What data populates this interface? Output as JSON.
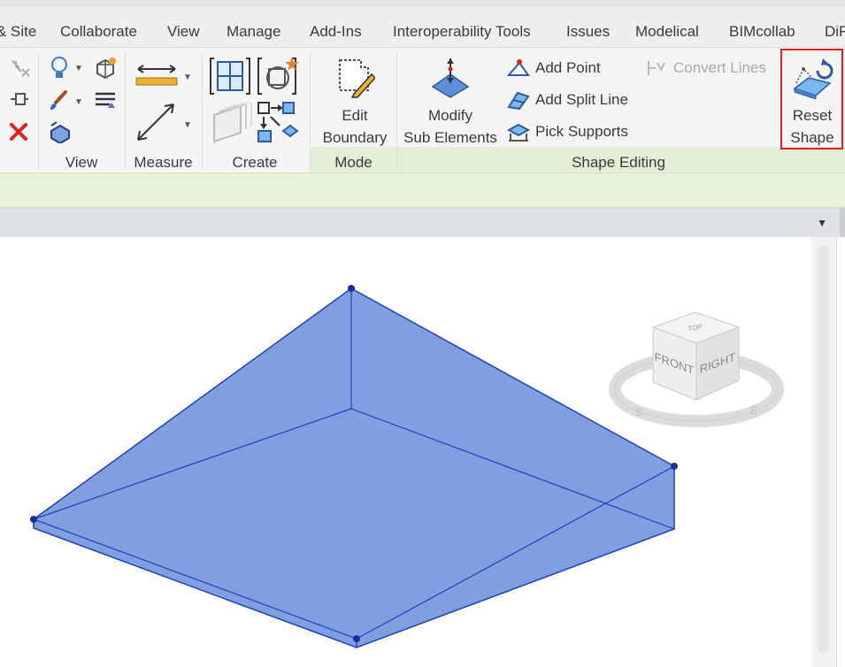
{
  "tabs": [
    "& Site",
    "Collaborate",
    "View",
    "Manage",
    "Add-Ins",
    "Interoperability Tools",
    "Issues",
    "Modelical",
    "BIMcollab",
    "DiR"
  ],
  "panels": {
    "view": "View",
    "measure": "Measure",
    "create": "Create",
    "mode": "Mode",
    "shape_editing": "Shape Editing"
  },
  "buttons": {
    "edit_boundary_line1": "Edit",
    "edit_boundary_line2": "Boundary",
    "modify_sub_line1": "Modify",
    "modify_sub_line2": "Sub Elements",
    "add_point": "Add Point",
    "add_split_line": "Add Split Line",
    "pick_supports": "Pick Supports",
    "convert_lines": "Convert Lines",
    "reset_shape_line1": "Reset",
    "reset_shape_line2": "Shape"
  },
  "viewcube": {
    "top": "TOP",
    "front": "FRONT",
    "right": "RIGHT",
    "compass_s": "S",
    "compass_e": "E"
  },
  "colors": {
    "shape_fill": "#7f9fdf",
    "shape_edge": "#1f3fbf",
    "highlight": "#e02020",
    "options_bar": "#e7f2da"
  }
}
